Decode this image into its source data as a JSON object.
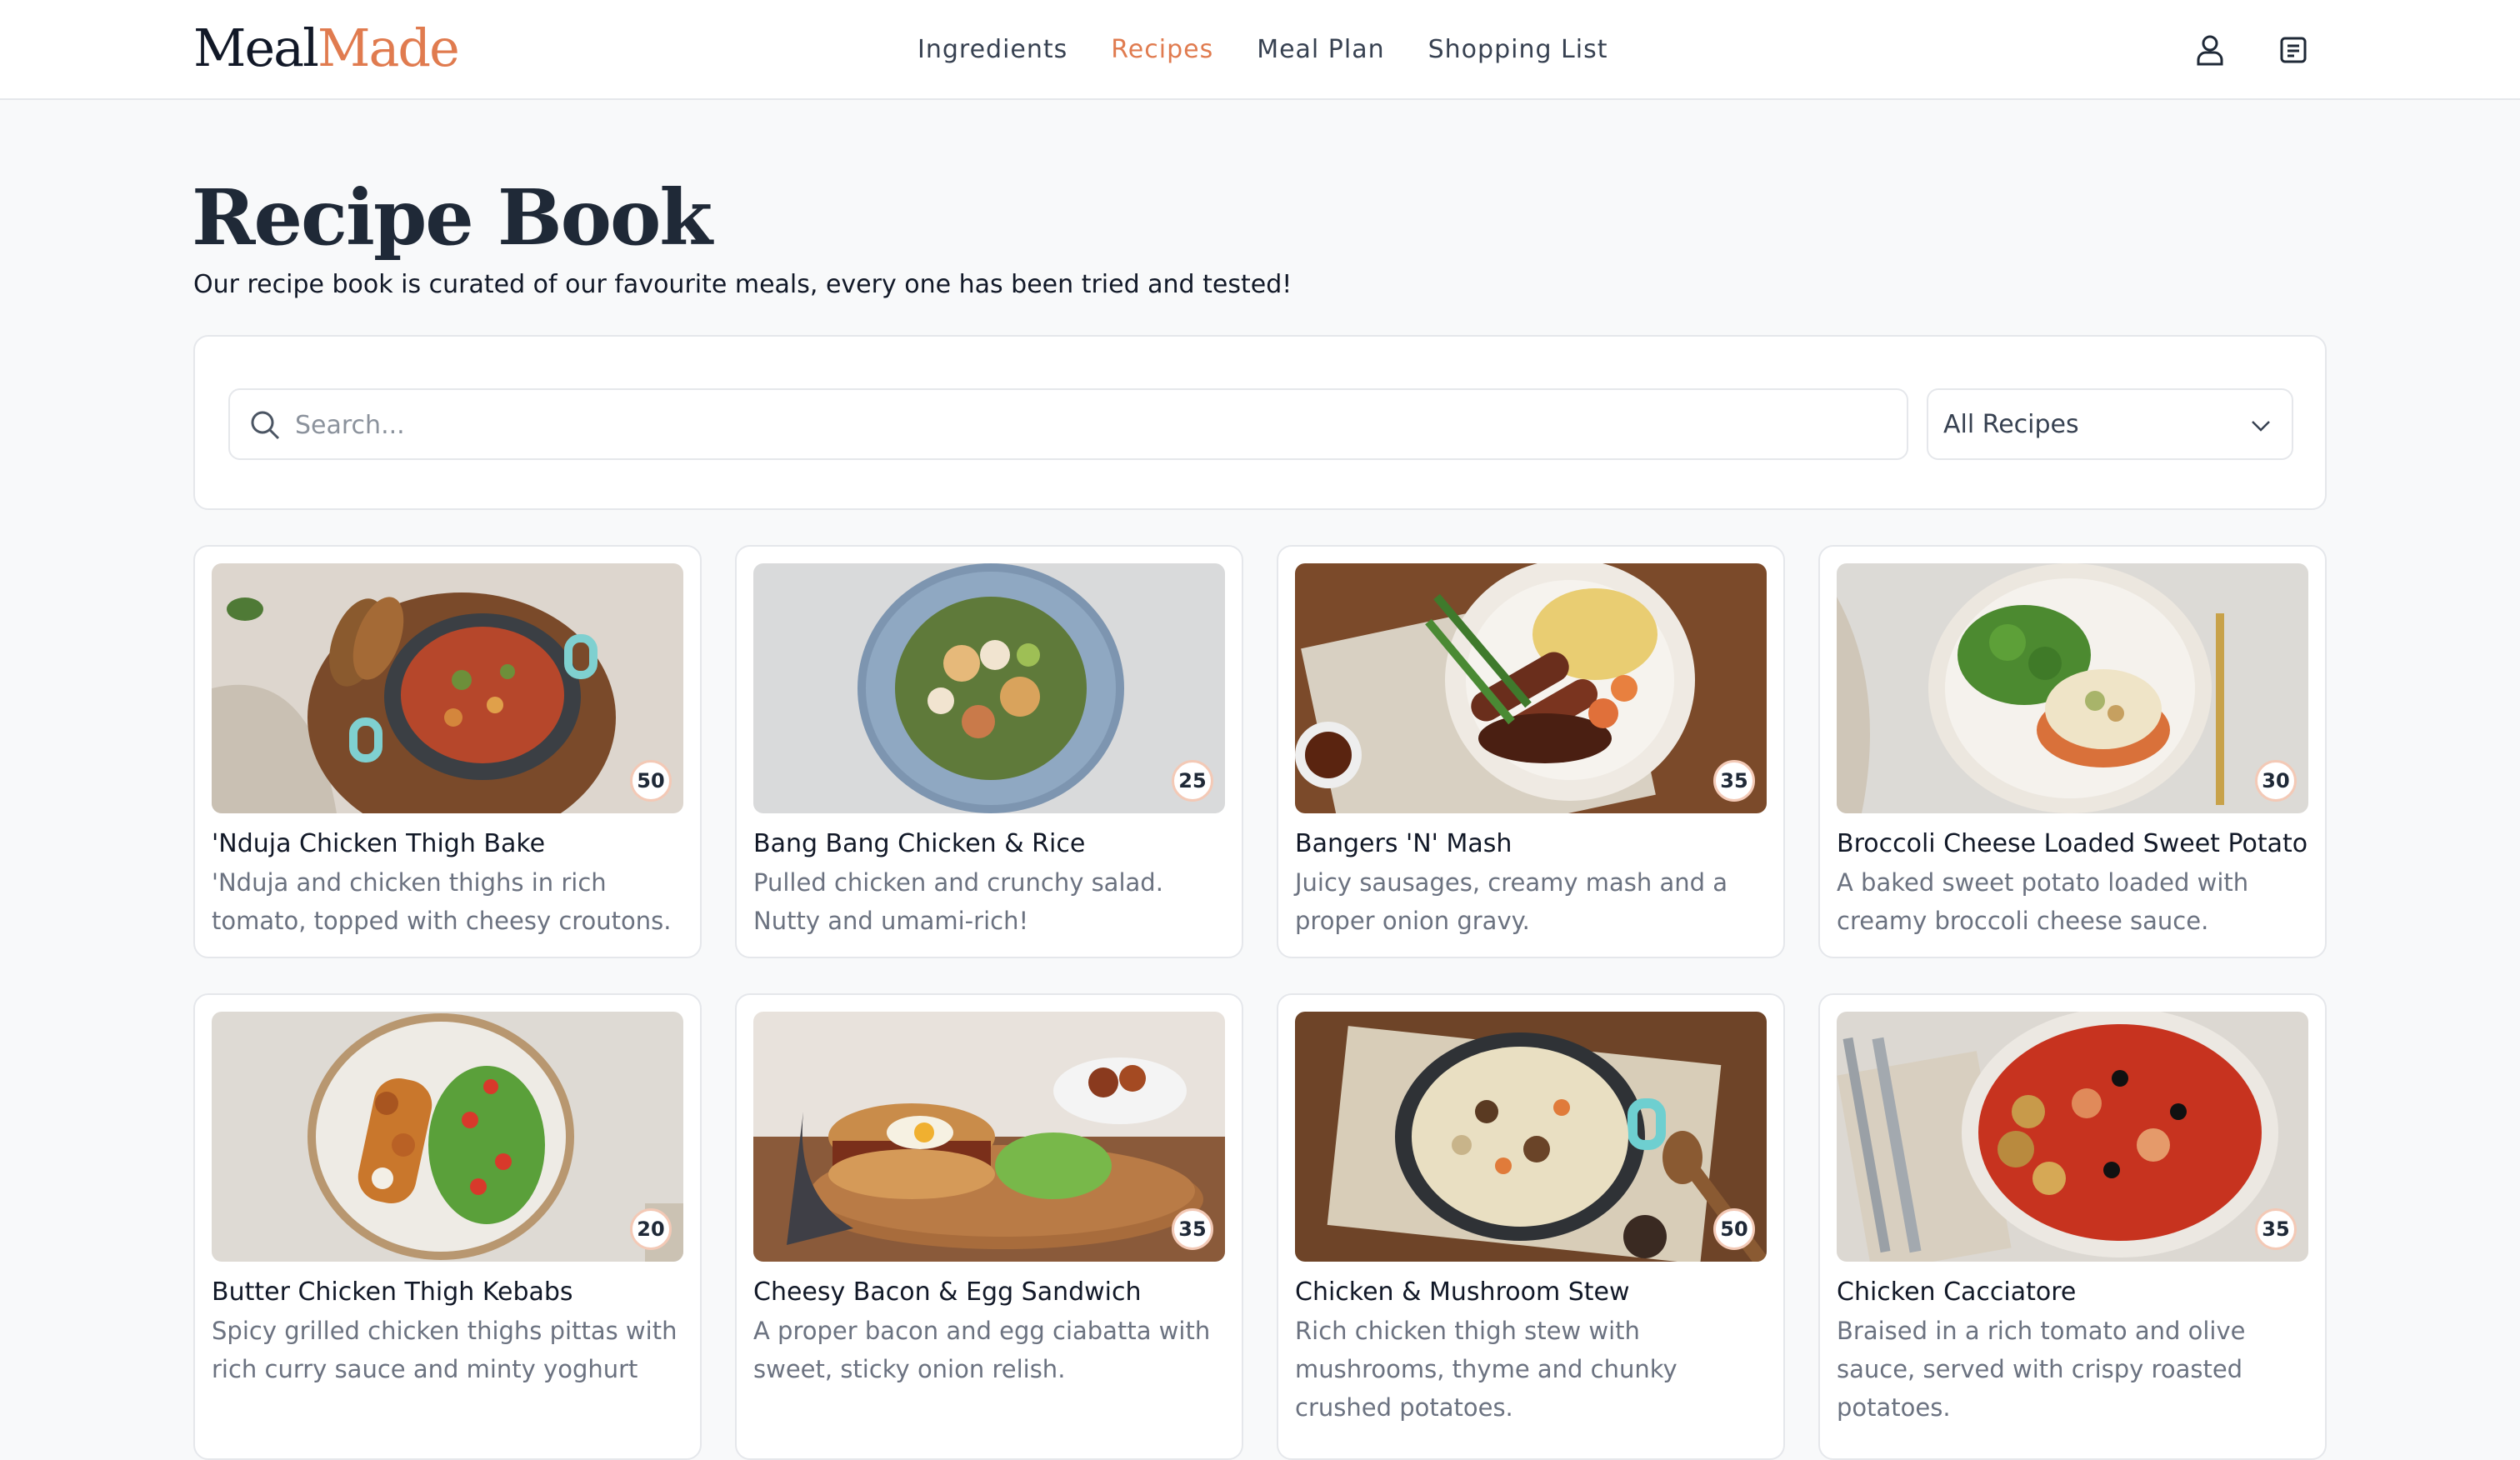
{
  "brand": {
    "part1": "Meal",
    "part2": "Made",
    "accent": "#e07b4f"
  },
  "nav": {
    "items": [
      {
        "label": "Ingredients",
        "active": false
      },
      {
        "label": "Recipes",
        "active": true
      },
      {
        "label": "Meal Plan",
        "active": false
      },
      {
        "label": "Shopping List",
        "active": false
      }
    ]
  },
  "header_icons": {
    "account": "user-icon",
    "list": "receipt-icon"
  },
  "page": {
    "title": "Recipe Book",
    "subtitle": "Our recipe book is curated of our favourite meals, every one has been tried and tested!"
  },
  "search": {
    "placeholder": "Search...",
    "value": ""
  },
  "filter": {
    "selected": "All Recipes"
  },
  "recipes": [
    {
      "title": "'Nduja Chicken Thigh Bake",
      "description": "'Nduja and chicken thighs in rich tomato, topped with cheesy croutons.",
      "time": "50"
    },
    {
      "title": "Bang Bang Chicken & Rice",
      "description": "Pulled chicken and crunchy salad. Nutty and umami-rich!",
      "time": "25"
    },
    {
      "title": "Bangers 'N' Mash",
      "description": "Juicy sausages, creamy mash and a proper onion gravy.",
      "time": "35"
    },
    {
      "title": "Broccoli Cheese Loaded Sweet Potato",
      "description": "A baked sweet potato loaded with creamy broccoli cheese sauce.",
      "time": "30"
    },
    {
      "title": "Butter Chicken Thigh Kebabs",
      "description": "Spicy grilled chicken thighs pittas with rich curry sauce and minty yoghurt",
      "time": "20"
    },
    {
      "title": "Cheesy Bacon & Egg Sandwich",
      "description": "A proper bacon and egg ciabatta with sweet, sticky onion relish.",
      "time": "35"
    },
    {
      "title": "Chicken & Mushroom Stew",
      "description": "Rich chicken thigh stew with mushrooms, thyme and chunky crushed potatoes.",
      "time": "50"
    },
    {
      "title": "Chicken Cacciatore",
      "description": "Braised in a rich tomato and olive sauce, served with crispy roasted potatoes.",
      "time": "35"
    }
  ]
}
